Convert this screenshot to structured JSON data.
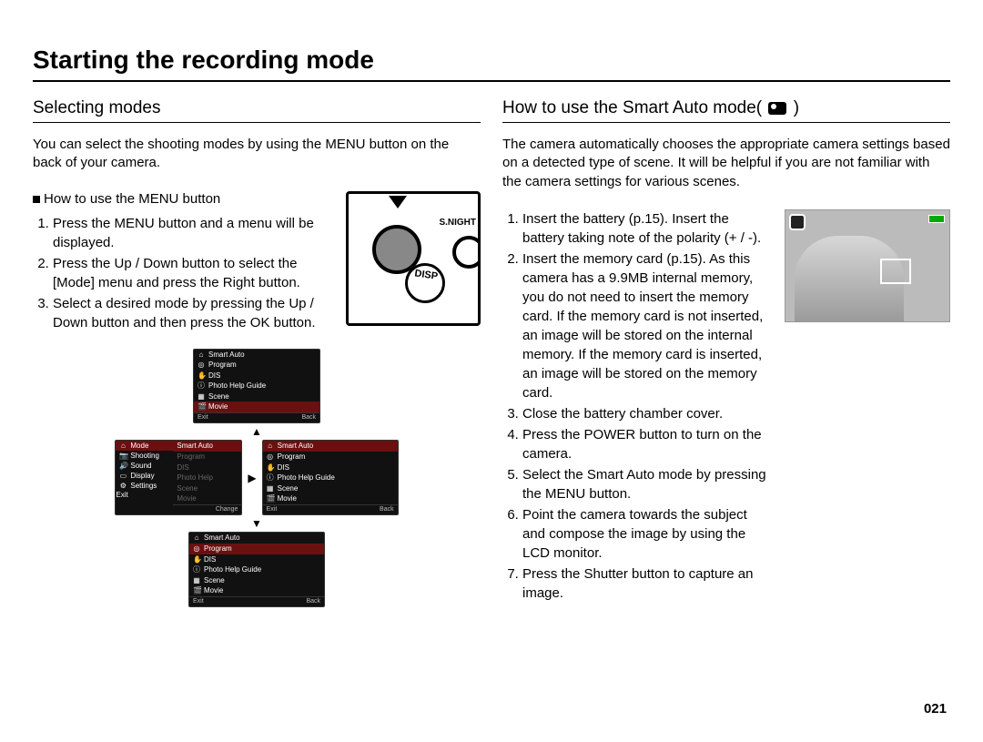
{
  "pageTitle": "Starting the recording mode",
  "pageNumber": "021",
  "left": {
    "heading": "Selecting modes",
    "intro": "You can select the shooting modes by using the MENU button on the back of your camera.",
    "subHeading": "How to use the MENU button",
    "steps": [
      "Press the MENU button and a menu will be displayed.",
      "Press the Up / Down button to select the [Mode] menu and press the Right button.",
      "Select a desired mode by pressing the Up / Down button and then press the OK button."
    ],
    "diagram": {
      "labelSNight": "S.NIGHT",
      "labelDisp": "DISP"
    },
    "menus": {
      "modeItems": [
        "Smart Auto",
        "Program",
        "DIS",
        "Photo Help Guide",
        "Scene",
        "Movie"
      ],
      "sidePane": [
        "Mode",
        "Shooting",
        "Sound",
        "Display",
        "Settings"
      ],
      "footerExit": "Exit",
      "footerBack": "Back",
      "footerChange": "Change",
      "topHighlight": "Movie",
      "wideHighlight": "Smart Auto",
      "bottomHighlight": "Program",
      "sideHighlight": "Mode"
    }
  },
  "right": {
    "heading": "How to use the Smart Auto mode(",
    "headingClose": ")",
    "intro": "The camera automatically chooses the appropriate camera settings based on a detected type of scene. It will be helpful if you are not familiar with the camera settings for various scenes.",
    "steps": [
      "Insert the battery (p.15). Insert the battery taking note of the polarity (+ / -).",
      "Insert the memory card (p.15). As this camera has a 9.9MB internal memory, you do not need to insert the memory card. If the memory card is not inserted, an image will be stored on the internal memory. If the memory card is inserted, an image will be stored on the memory card.",
      "Close the battery chamber cover.",
      "Press the POWER button to turn on the camera.",
      "Select the Smart Auto mode by pressing the MENU button.",
      "Point the camera towards the subject and compose the image by using the LCD monitor.",
      "Press the Shutter button to capture an image."
    ]
  }
}
